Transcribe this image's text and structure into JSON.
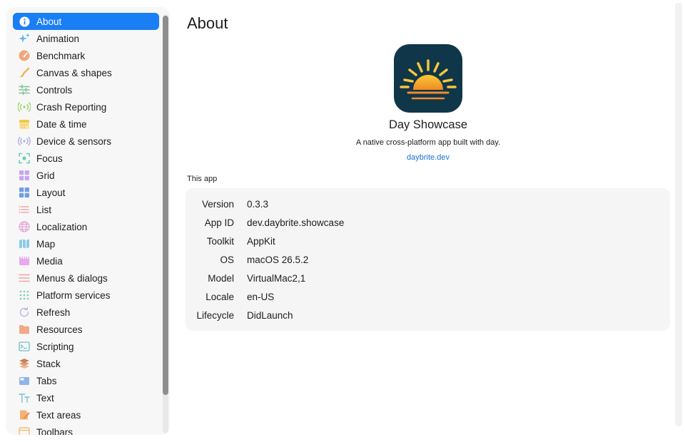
{
  "sidebar": {
    "items": [
      {
        "label": "About",
        "icon": "info-icon",
        "selected": true
      },
      {
        "label": "Animation",
        "icon": "sparkles-icon"
      },
      {
        "label": "Benchmark",
        "icon": "gauge-icon"
      },
      {
        "label": "Canvas & shapes",
        "icon": "brush-icon"
      },
      {
        "label": "Controls",
        "icon": "sliders-icon"
      },
      {
        "label": "Crash Reporting",
        "icon": "broadcast-icon"
      },
      {
        "label": "Date & time",
        "icon": "calendar-icon"
      },
      {
        "label": "Device & sensors",
        "icon": "sensor-icon"
      },
      {
        "label": "Focus",
        "icon": "focus-icon"
      },
      {
        "label": "Grid",
        "icon": "grid-icon"
      },
      {
        "label": "Layout",
        "icon": "layout-icon"
      },
      {
        "label": "List",
        "icon": "list-icon"
      },
      {
        "label": "Localization",
        "icon": "globe-icon"
      },
      {
        "label": "Map",
        "icon": "map-icon"
      },
      {
        "label": "Media",
        "icon": "film-icon"
      },
      {
        "label": "Menus & dialogs",
        "icon": "menu-icon"
      },
      {
        "label": "Platform services",
        "icon": "dots-grid-icon"
      },
      {
        "label": "Refresh",
        "icon": "refresh-icon"
      },
      {
        "label": "Resources",
        "icon": "folder-icon"
      },
      {
        "label": "Scripting",
        "icon": "terminal-icon"
      },
      {
        "label": "Stack",
        "icon": "layers-icon"
      },
      {
        "label": "Tabs",
        "icon": "tabs-icon"
      },
      {
        "label": "Text",
        "icon": "text-icon"
      },
      {
        "label": "Text areas",
        "icon": "edit-doc-icon"
      },
      {
        "label": "Toolbars",
        "icon": "toolbar-icon"
      }
    ]
  },
  "main": {
    "title": "About",
    "app_name": "Day Showcase",
    "description": "A native cross-platform app built with day.",
    "link": "daybrite.dev",
    "section_title": "This app",
    "info": [
      {
        "label": "Version",
        "value": "0.3.3"
      },
      {
        "label": "App ID",
        "value": "dev.daybrite.showcase"
      },
      {
        "label": "Toolkit",
        "value": "AppKit"
      },
      {
        "label": "OS",
        "value": "macOS 26.5.2"
      },
      {
        "label": "Model",
        "value": "VirtualMac2,1"
      },
      {
        "label": "Locale",
        "value": "en-US"
      },
      {
        "label": "Lifecycle",
        "value": "DidLaunch"
      }
    ]
  },
  "colors": {
    "accent": "#1a7ef5",
    "link": "#1a6fd6",
    "app_icon_bg": "#0f3649",
    "sun": "#f7b52c"
  }
}
